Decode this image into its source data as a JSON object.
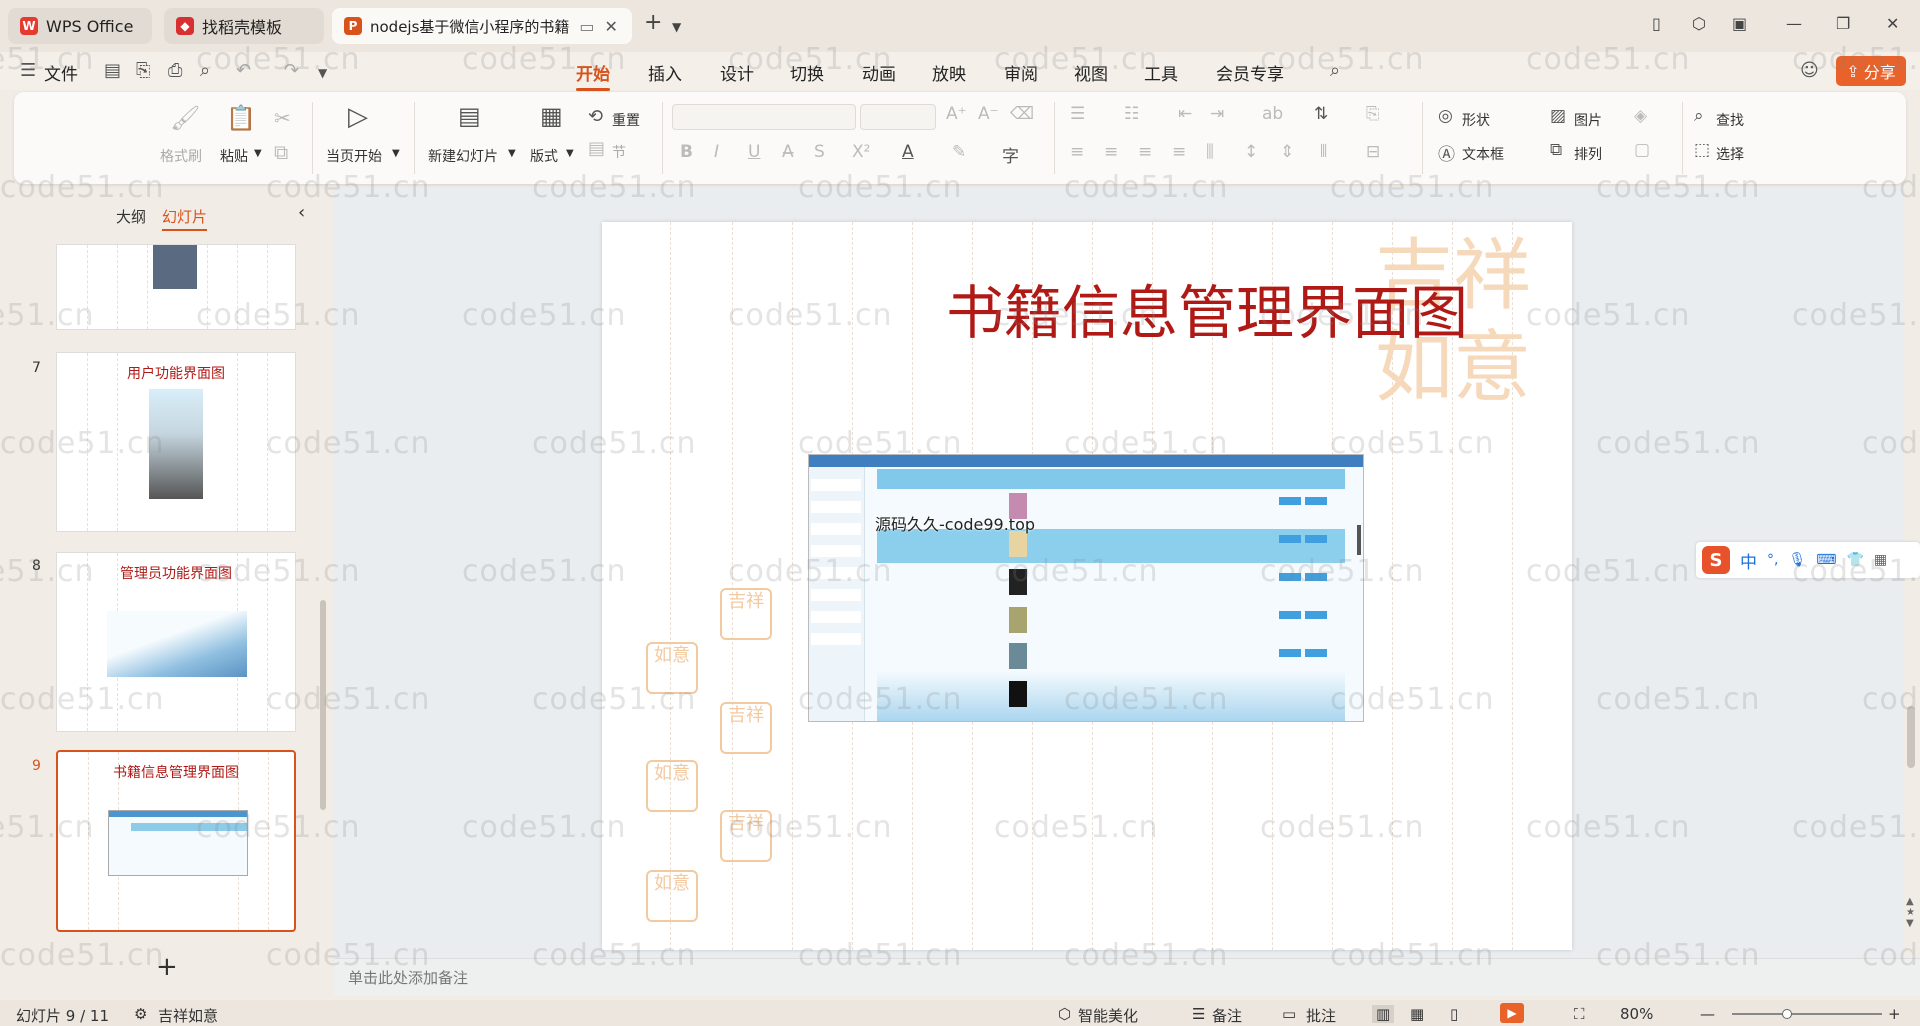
{
  "titlebar": {
    "tabs": [
      {
        "label": "WPS Office"
      },
      {
        "label": "找稻壳模板"
      },
      {
        "label": "nodejs基于微信小程序的书籍"
      }
    ]
  },
  "menubar": {
    "file": "文件",
    "items": [
      "开始",
      "插入",
      "设计",
      "切换",
      "动画",
      "放映",
      "审阅",
      "视图",
      "工具",
      "会员专享"
    ],
    "share": "分享"
  },
  "ribbon": {
    "format_brush": "格式刷",
    "paste": "粘贴",
    "play_from_current": "当页开始",
    "new_slide": "新建幻灯片",
    "layout": "版式",
    "reset": "重置",
    "section": "节",
    "shape": "形状",
    "picture": "图片",
    "find": "查找",
    "textbox": "文本框",
    "arrange": "排列",
    "select": "选择"
  },
  "leftpanel": {
    "tab_outline": "大纲",
    "tab_slides": "幻灯片",
    "slides": [
      {
        "num": "7",
        "title": "用户功能界面图"
      },
      {
        "num": "8",
        "title": "管理员功能界面图"
      },
      {
        "num": "9",
        "title": "书籍信息管理界面图"
      }
    ]
  },
  "slide": {
    "title": "书籍信息管理界面图",
    "overlay_text": "源码久久-code99.top"
  },
  "notes": {
    "placeholder": "单击此处添加备注"
  },
  "ime": {
    "lang": "中"
  },
  "statusbar": {
    "slide_info": "幻灯片 9 / 11",
    "theme": "吉祥如意",
    "beautify": "智能美化",
    "notes": "备注",
    "comments": "批注",
    "zoom": "80%"
  },
  "watermark": "code51.cn",
  "colors": {
    "accent": "#d8531b",
    "title_red": "#b01a16"
  }
}
